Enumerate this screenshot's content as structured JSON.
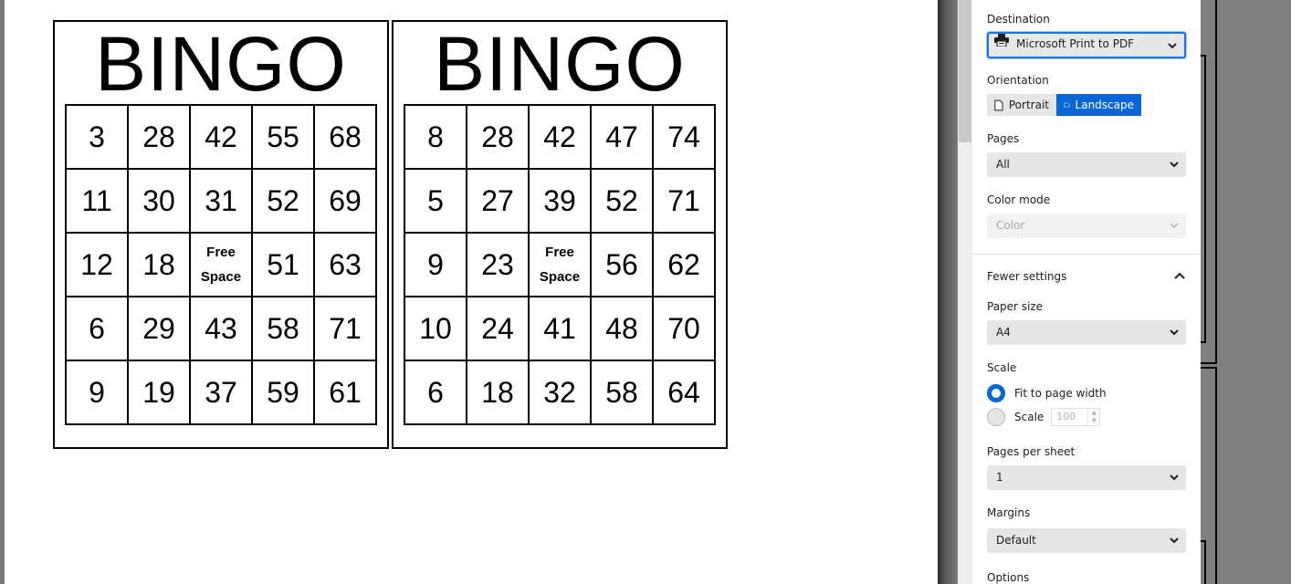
{
  "preview": {
    "cards": [
      {
        "title": "BINGO",
        "rows": [
          [
            "3",
            "28",
            "42",
            "55",
            "68"
          ],
          [
            "11",
            "30",
            "31",
            "52",
            "69"
          ],
          [
            "12",
            "18",
            "FREE",
            "51",
            "63"
          ],
          [
            "6",
            "29",
            "43",
            "58",
            "71"
          ],
          [
            "9",
            "19",
            "37",
            "59",
            "61"
          ]
        ]
      },
      {
        "title": "BINGO",
        "rows": [
          [
            "8",
            "28",
            "42",
            "47",
            "74"
          ],
          [
            "5",
            "27",
            "39",
            "52",
            "71"
          ],
          [
            "9",
            "23",
            "FREE",
            "56",
            "62"
          ],
          [
            "10",
            "24",
            "41",
            "48",
            "70"
          ],
          [
            "6",
            "18",
            "32",
            "58",
            "64"
          ]
        ]
      }
    ],
    "free_space_line1": "Free",
    "free_space_line2": "Space"
  },
  "settings": {
    "destination": {
      "label": "Destination",
      "value": "Microsoft Print to PDF",
      "icon": "printer-icon"
    },
    "orientation": {
      "label": "Orientation",
      "options": [
        {
          "label": "Portrait",
          "icon": "portrait-page-icon",
          "selected": false
        },
        {
          "label": "Landscape",
          "icon": "landscape-page-icon",
          "selected": true
        }
      ]
    },
    "pages": {
      "label": "Pages",
      "value": "All"
    },
    "color_mode": {
      "label": "Color mode",
      "value": "Color",
      "disabled": true
    },
    "fewer_settings": {
      "label": "Fewer settings",
      "icon": "chevron-up-icon"
    },
    "paper_size": {
      "label": "Paper size",
      "value": "A4"
    },
    "scale": {
      "label": "Scale",
      "options": [
        {
          "label": "Fit to page width",
          "selected": true
        },
        {
          "label": "Scale",
          "selected": false,
          "value": "100"
        }
      ]
    },
    "pages_per_sheet": {
      "label": "Pages per sheet",
      "value": "1"
    },
    "margins": {
      "label": "Margins",
      "value": "Default"
    },
    "options": {
      "label": "Options"
    }
  },
  "colors": {
    "accent": "#0a66d6",
    "focus_ring": "#1a73e8",
    "select_bg": "#e6e6e6",
    "backdrop": "#808080"
  }
}
